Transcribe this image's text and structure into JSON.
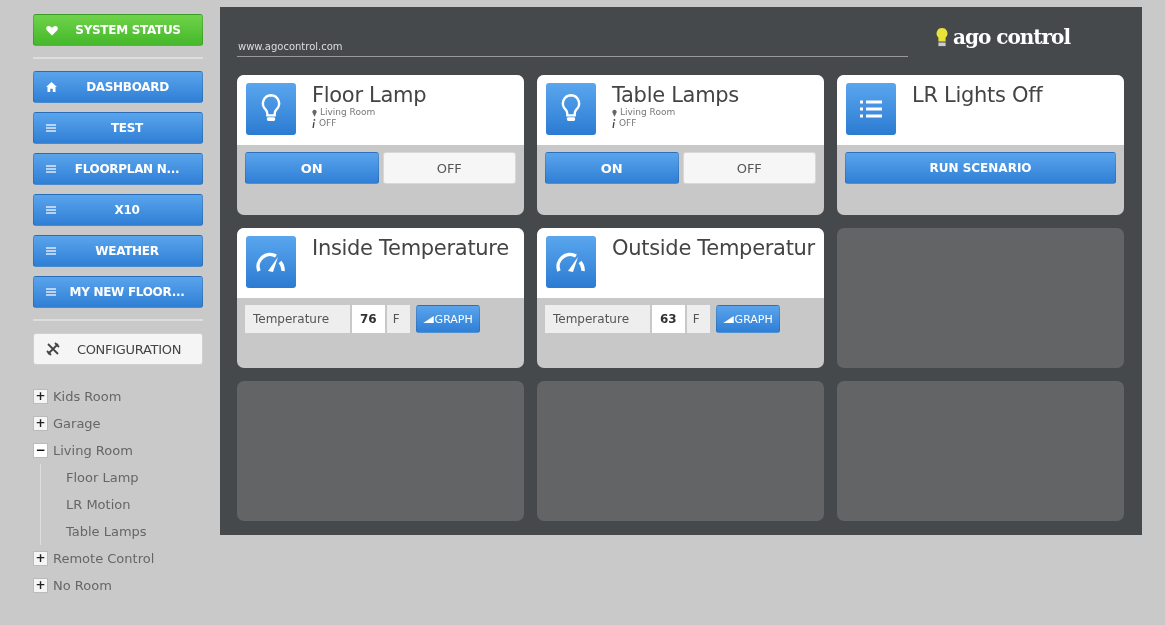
{
  "sidebar": {
    "status_button": "SYSTEM STATUS",
    "nav": [
      {
        "label": "DASHBOARD",
        "kind": "home"
      },
      {
        "label": "TEST",
        "kind": "page"
      },
      {
        "label": "FLOORPLAN N...",
        "kind": "page"
      },
      {
        "label": "X10",
        "kind": "page"
      },
      {
        "label": "WEATHER",
        "kind": "page"
      },
      {
        "label": "MY NEW FLOOR...",
        "kind": "page"
      }
    ],
    "config_button": "CONFIGURATION",
    "tree": [
      {
        "label": "Kids Room",
        "expanded": false,
        "toggle": "+"
      },
      {
        "label": "Garage",
        "expanded": false,
        "toggle": "+"
      },
      {
        "label": "Living Room",
        "expanded": true,
        "toggle": "−",
        "children": [
          {
            "label": "Floor Lamp"
          },
          {
            "label": "LR Motion"
          },
          {
            "label": "Table Lamps"
          }
        ]
      },
      {
        "label": "Remote Control",
        "expanded": false,
        "toggle": "+"
      },
      {
        "label": "No Room",
        "expanded": false,
        "toggle": "+"
      }
    ]
  },
  "header": {
    "url": "www.agocontrol.com",
    "logo": "ago control"
  },
  "widgets": [
    {
      "kind": "switch",
      "title": "Floor Lamp",
      "room": "Living Room",
      "state": "OFF",
      "buttons": [
        {
          "label": "ON",
          "selected": true
        },
        {
          "label": "OFF",
          "selected": false
        }
      ]
    },
    {
      "kind": "switch",
      "title": "Table Lamps",
      "room": "Living Room",
      "state": "OFF",
      "buttons": [
        {
          "label": "ON",
          "selected": true
        },
        {
          "label": "OFF",
          "selected": false
        }
      ]
    },
    {
      "kind": "scenario",
      "title": "LR Lights Off",
      "button": "RUN SCENARIO"
    },
    {
      "kind": "sensor",
      "title": "Inside Temperature",
      "label": "Temperature",
      "value": "76",
      "unit": "F",
      "button": "GRAPH"
    },
    {
      "kind": "sensor",
      "title": "Outside Temperatur",
      "label": "Temperature",
      "value": "63",
      "unit": "F",
      "button": "GRAPH"
    },
    {
      "kind": "empty"
    },
    {
      "kind": "empty"
    },
    {
      "kind": "empty"
    },
    {
      "kind": "empty"
    }
  ]
}
